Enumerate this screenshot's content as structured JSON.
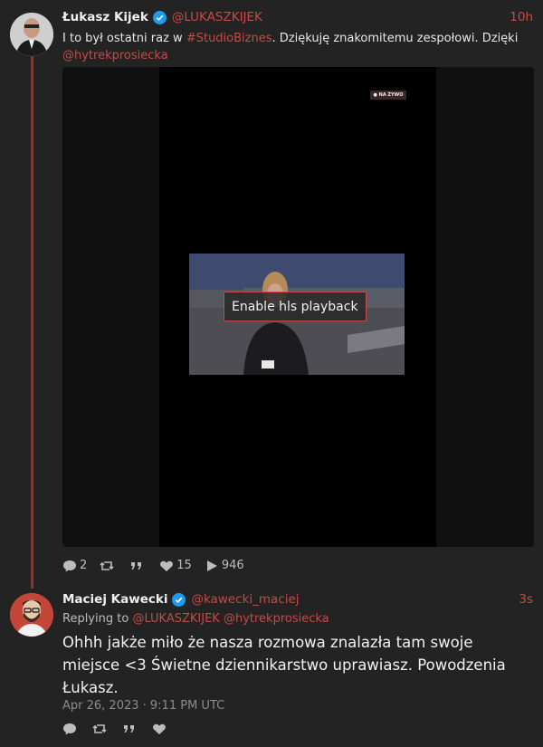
{
  "tweet1": {
    "name": "Łukasz Kijek",
    "handle": "@LUKASZKIJEK",
    "time": "10h",
    "text_plain1": "I to był ostatni raz w ",
    "hashtag": "#StudioBiznes",
    "text_plain2": ". Dziękuję znakomitemu zespołowi. Dzięki ",
    "mention": "@hytrekprosiecka",
    "video": {
      "live_badge": "● NA ŻYWO",
      "enable_label": "Enable hls playback"
    },
    "stats": {
      "replies": "2",
      "likes": "15",
      "views": "946"
    }
  },
  "tweet2": {
    "name": "Maciej Kawecki",
    "handle": "@kawecki_maciej",
    "time": "3s",
    "replying_prefix": "Replying to ",
    "replying_to": "@LUKASZKIJEK @hytrekprosiecka",
    "text": "Ohhh jakże miło że nasza rozmowa znalazła tam swoje miejsce <3 Świetne dziennikarstwo uprawiasz. Powodzenia Łukasz.",
    "date": "Apr 26, 2023 · 9:11 PM UTC"
  },
  "colors": {
    "accent": "#c64a45",
    "background": "#232323",
    "verified": "#1d9bf0"
  },
  "icons": [
    "verified-badge-icon",
    "comment-icon",
    "retweet-icon",
    "quote-icon",
    "heart-icon",
    "play-icon"
  ]
}
